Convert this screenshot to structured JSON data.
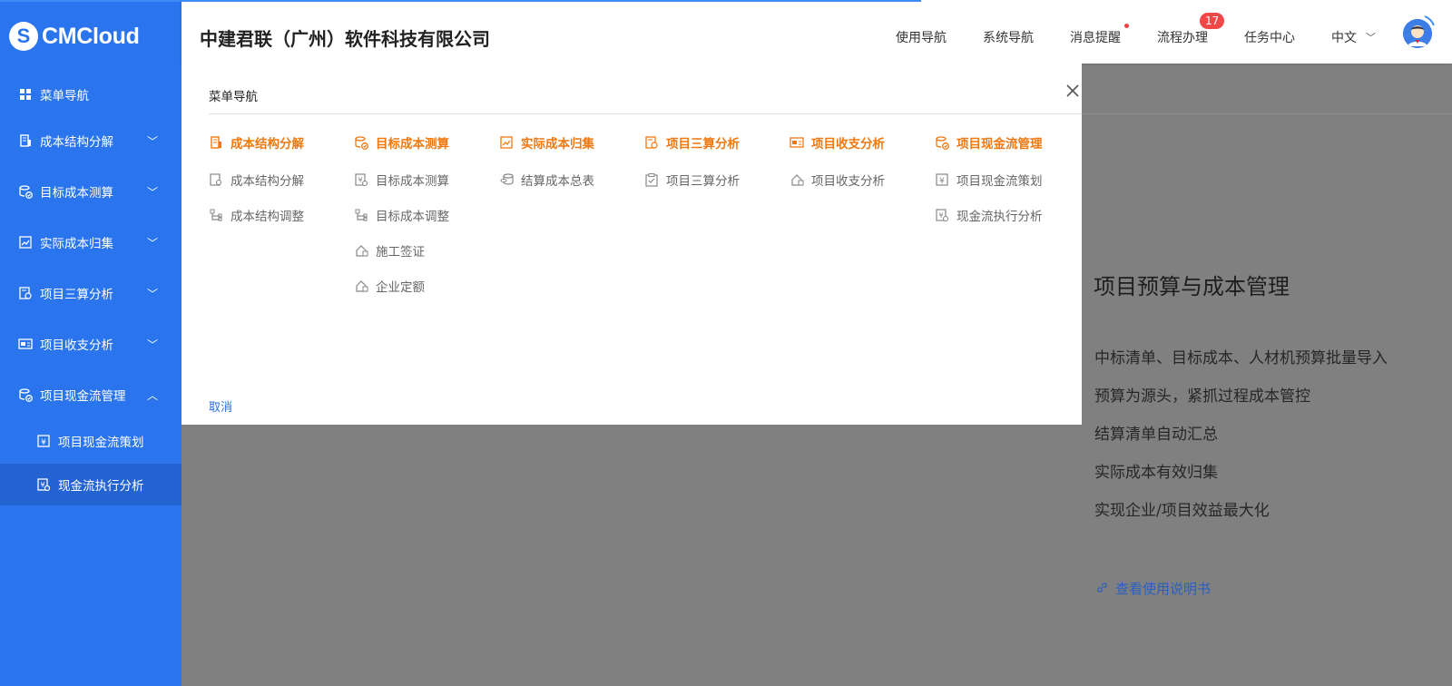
{
  "brand": {
    "logo_letter": "S",
    "logo_text": "CMCloud"
  },
  "sidebar": {
    "items": [
      {
        "label": "菜单导航",
        "icon": "grid-icon",
        "chevron": ""
      },
      {
        "label": "成本结构分解",
        "icon": "building-icon",
        "chevron": "﹀"
      },
      {
        "label": "目标成本测算",
        "icon": "coins-check-icon",
        "chevron": "﹀"
      },
      {
        "label": "实际成本归集",
        "icon": "chart-doc-icon",
        "chevron": "﹀"
      },
      {
        "label": "项目三算分析",
        "icon": "doc-gear-icon",
        "chevron": "﹀"
      },
      {
        "label": "项目收支分析",
        "icon": "card-icon",
        "chevron": "﹀"
      },
      {
        "label": "项目现金流管理",
        "icon": "coins-check-icon",
        "chevron": "︿"
      }
    ],
    "sub_items": [
      {
        "label": "项目现金流策划",
        "icon": "yen-box-icon"
      },
      {
        "label": "现金流执行分析",
        "icon": "yen-search-icon"
      }
    ]
  },
  "header": {
    "company": "中建君联（广州）软件科技有限公司",
    "nav": [
      {
        "label": "使用导航"
      },
      {
        "label": "系统导航"
      },
      {
        "label": "消息提醒"
      },
      {
        "label": "流程办理"
      },
      {
        "label": "任务中心"
      }
    ],
    "badge_count": "17",
    "language": "中文",
    "language_chevron": "﹀"
  },
  "panel": {
    "title": "菜单导航",
    "cancel_label": "取消",
    "columns": [
      {
        "head": "成本结构分解",
        "head_icon": "building-icon",
        "links": [
          {
            "label": "成本结构分解",
            "icon": "doc-search-icon"
          },
          {
            "label": "成本结构调整",
            "icon": "tree-icon"
          }
        ]
      },
      {
        "head": "目标成本测算",
        "head_icon": "coins-check-icon",
        "links": [
          {
            "label": "目标成本测算",
            "icon": "yen-search-icon"
          },
          {
            "label": "目标成本调整",
            "icon": "tree-icon"
          },
          {
            "label": "施工签证",
            "icon": "house-icon"
          },
          {
            "label": "企业定额",
            "icon": "house-icon"
          }
        ]
      },
      {
        "head": "实际成本归集",
        "head_icon": "chart-doc-icon",
        "links": [
          {
            "label": "结算成本总表",
            "icon": "coins-icon"
          }
        ]
      },
      {
        "head": "项目三算分析",
        "head_icon": "doc-gear-icon",
        "links": [
          {
            "label": "项目三算分析",
            "icon": "clipboard-check-icon"
          }
        ]
      },
      {
        "head": "项目收支分析",
        "head_icon": "card-icon",
        "links": [
          {
            "label": "项目收支分析",
            "icon": "house-icon"
          }
        ]
      },
      {
        "head": "项目现金流管理",
        "head_icon": "coins-check-icon",
        "links": [
          {
            "label": "项目现金流策划",
            "icon": "yen-box-icon"
          },
          {
            "label": "现金流执行分析",
            "icon": "yen-search-icon"
          }
        ]
      }
    ]
  },
  "background": {
    "title": "项目预算与成本管理",
    "lines": [
      "中标清单、目标成本、人材机预算批量导入",
      "预算为源头，紧抓过程成本管控",
      "结算清单自动汇总",
      "实际成本有效归集",
      "实现企业/项目效益最大化"
    ],
    "link": "查看使用说明书"
  },
  "colors": {
    "sidebar": "#2a75ee",
    "accent_orange": "#f07810",
    "badge": "#f04848",
    "link": "#2a6fd8"
  }
}
